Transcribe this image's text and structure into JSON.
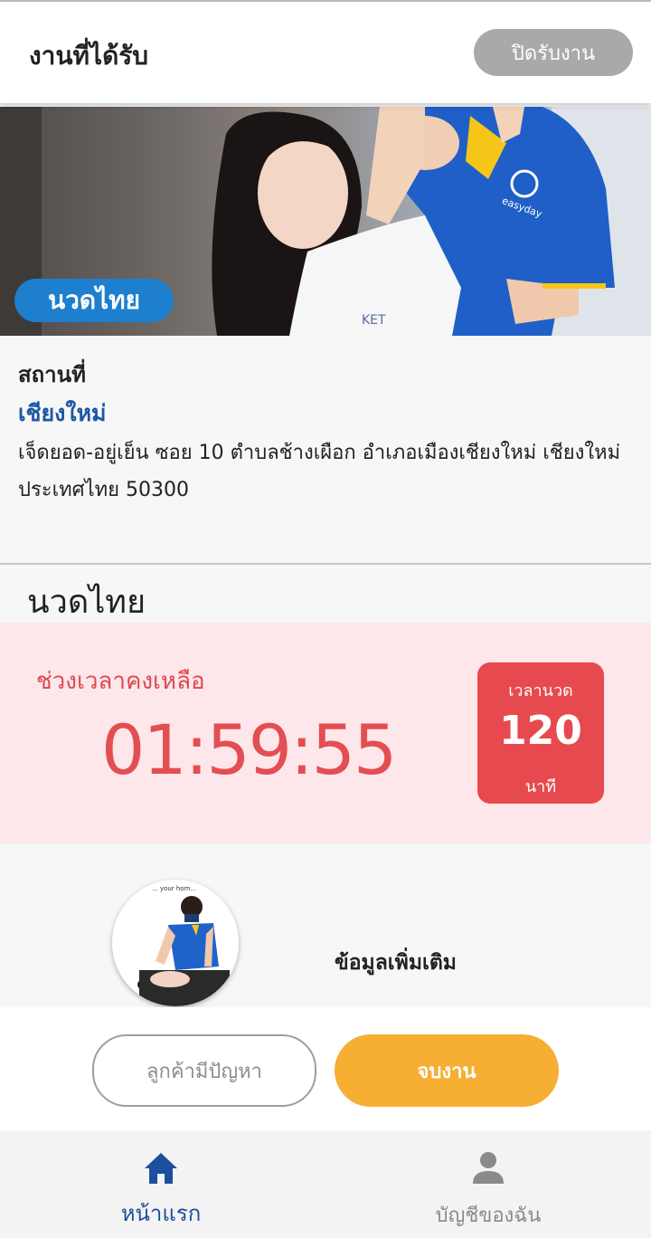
{
  "header": {
    "title": "งานที่ได้รับ",
    "close_button": "ปิดรับงาน"
  },
  "hero": {
    "badge": "นวดไทย",
    "shirt_logo_text": "easyday"
  },
  "location": {
    "label": "สถานที่",
    "city": "เชียงใหม่",
    "address": "เจ็ดยอด-อยู่เย็น ซอย 10 ตำบลช้างเผือก อำเภอเมืองเชียงใหม่ เชียงใหม่ ประเทศไทย 50300"
  },
  "service": {
    "title": "นวดไทย"
  },
  "timer": {
    "label": "ช่วงเวลาคงเหลือ",
    "remaining": "01:59:55",
    "duration_label": "เวลานวด",
    "duration_value": "120",
    "duration_unit": "นาที"
  },
  "extra": {
    "avatar_text": "... your hom...",
    "more_info": "ข้อมูลเพิ่มเติม"
  },
  "actions": {
    "problem_button": "ลูกค้ามีปัญหา",
    "finish_button": "จบงาน"
  },
  "nav": {
    "home": "หน้าแรก",
    "account": "บัญชีของฉัน"
  },
  "colors": {
    "primary_blue": "#1c57a5",
    "badge_blue": "#1e7fcf",
    "timer_red": "#e34e52",
    "timer_bg": "#fde7ea",
    "finish_orange": "#f6ae33",
    "close_gray": "#a9a9a9"
  },
  "icons": {
    "home": "home-icon",
    "account": "person-icon"
  }
}
